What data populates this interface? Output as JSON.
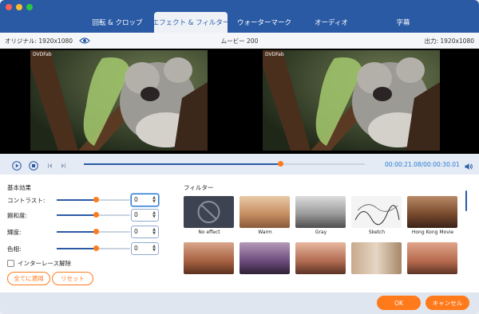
{
  "window": {
    "dots": [
      "#fc5f57",
      "#fdbc2e",
      "#28c840"
    ]
  },
  "tabs": [
    {
      "label": "回転 & クロップ"
    },
    {
      "label": "エフェクト & フィルター"
    },
    {
      "label": "ウォーターマーク"
    },
    {
      "label": "オーディオ"
    },
    {
      "label": "字幕"
    }
  ],
  "info": {
    "original": "オリジナル: 1920x1080",
    "movie": "ムービー 200",
    "output": "出力: 1920x1080"
  },
  "preview": {
    "watermark": "DVDFab"
  },
  "player": {
    "progress": 0.7,
    "current_time": "00:00:21.08",
    "total_time": "/00:00:30.01"
  },
  "basic": {
    "title": "基本効果",
    "rows": [
      {
        "label": "コントラスト:",
        "value": "0",
        "level": 0.54
      },
      {
        "label": "飽和度:",
        "value": "0",
        "level": 0.54
      },
      {
        "label": "輝度:",
        "value": "0",
        "level": 0.54
      },
      {
        "label": "色相:",
        "value": "0",
        "level": 0.54
      }
    ],
    "interlace": "インターレース解除",
    "apply_all": "全てに適用",
    "reset": "リセット"
  },
  "filters": {
    "title": "フィルター",
    "items": [
      {
        "label": "No effect"
      },
      {
        "label": "Warm"
      },
      {
        "label": "Gray"
      },
      {
        "label": "Sketch"
      },
      {
        "label": "Hong Kong Movie"
      },
      {
        "label": ""
      },
      {
        "label": ""
      },
      {
        "label": ""
      },
      {
        "label": ""
      },
      {
        "label": ""
      }
    ]
  },
  "footer": {
    "ok": "OK",
    "cancel": "キャンセル"
  },
  "colors": {
    "accent": "#2b5aa5",
    "orange": "#ff7a1a"
  }
}
